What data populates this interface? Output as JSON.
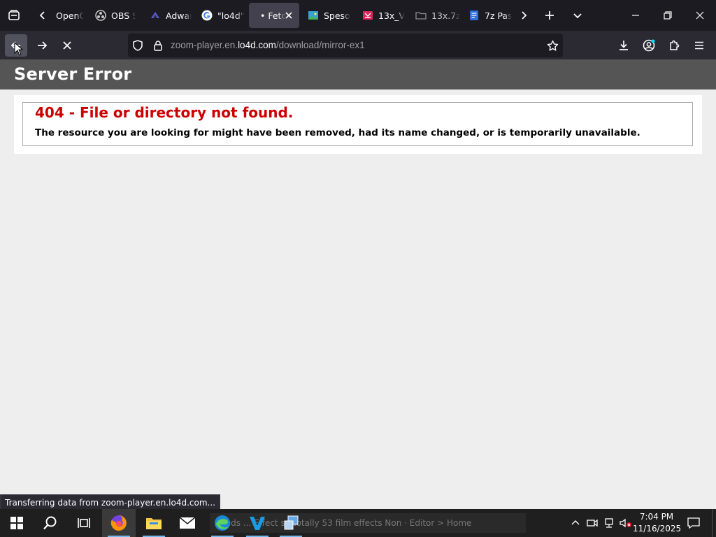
{
  "browser": {
    "tabs": [
      {
        "title": "OpenC",
        "favicon": "loading-spinner"
      },
      {
        "title": "OBS S",
        "favicon": "obs-icon"
      },
      {
        "title": "Adwar",
        "favicon": "adwaita-icon"
      },
      {
        "title": "\"lo4d\"",
        "favicon": "google-icon"
      },
      {
        "title": "• Fetc",
        "favicon": "none"
      },
      {
        "title": "Speso",
        "favicon": "image-icon"
      },
      {
        "title": "13x_V",
        "favicon": "archive-icon"
      },
      {
        "title": "13x.7z",
        "favicon": "folder-icon"
      },
      {
        "title": "7z Pas",
        "favicon": "document-icon"
      }
    ],
    "active_tab_index": 4,
    "url": {
      "prefix": "zoom-player.en.",
      "host": "lo4d.com",
      "path": "/download/mirror-ex1"
    },
    "status_text": "Transferring data from zoom-player.en.lo4d.com..."
  },
  "page": {
    "header_title": "Server Error",
    "error_title": "404 - File or directory not found.",
    "error_message": "The resource you are looking for might have been removed, had its name changed, or is temporarily unavailable."
  },
  "taskbar": {
    "preview_text": "...leds ... Effect so totally 53 film effects Non · Editor > Home",
    "clock": {
      "time": "7:04 PM",
      "date": "11/16/2025"
    }
  },
  "colors": {
    "tabbar_bg": "#1c1b22",
    "navbar_bg": "#2b2a33",
    "header_bg": "#555555",
    "error_red": "#cc0000",
    "taskbar_bg": "#1f1f1f"
  }
}
